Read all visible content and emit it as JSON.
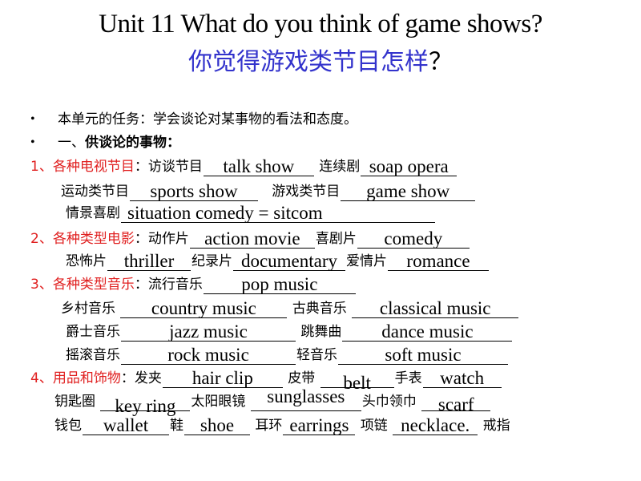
{
  "title": {
    "english": "Unit 11 What do you think of game shows?",
    "chinese": "你觉得游戏类节目怎样",
    "chinese_qmark": "？"
  },
  "bullets": [
    {
      "text": "本单元的任务：学会谈论对某事物的看法和态度。"
    },
    {
      "prefix": "一、",
      "text": "供谈论的事物："
    }
  ],
  "sections": [
    {
      "heading": "1、各种电视节目",
      "colon": "：",
      "items": [
        {
          "label": "访谈节目",
          "answer": "talk show"
        },
        {
          "label": "连续剧",
          "answer": "soap opera"
        },
        {
          "label": "运动类节目",
          "answer": "sports show"
        },
        {
          "label": "游戏类节目",
          "answer": "game show"
        },
        {
          "label": "情景喜剧",
          "answer": "situation comedy = sitcom"
        }
      ]
    },
    {
      "heading": "2、各种类型电影",
      "colon": "：",
      "items": [
        {
          "label": "动作片",
          "answer": "action movie"
        },
        {
          "label": "喜剧片",
          "answer": "comedy"
        },
        {
          "label": "恐怖片",
          "answer": "thriller"
        },
        {
          "label": "纪录片",
          "answer": "documentary"
        },
        {
          "label": "爱情片",
          "answer": "romance"
        }
      ]
    },
    {
      "heading": "3、各种类型音乐",
      "colon": "：",
      "items": [
        {
          "label": "流行音乐",
          "answer": "pop music"
        },
        {
          "label": "乡村音乐",
          "answer": "country  music"
        },
        {
          "label": "古典音乐",
          "answer": "classical music"
        },
        {
          "label": "爵士音乐",
          "answer": "jazz music"
        },
        {
          "label": "跳舞曲",
          "answer": "dance  music"
        },
        {
          "label": "摇滚音乐",
          "answer": "rock music"
        },
        {
          "label": "轻音乐",
          "answer": "soft music"
        }
      ]
    },
    {
      "heading": "4、用品和饰物",
      "colon": "：",
      "items": [
        {
          "label": "发夹",
          "answer": "hair clip"
        },
        {
          "label": "皮带",
          "answer": "belt"
        },
        {
          "label": "手表",
          "answer": "watch"
        },
        {
          "label": "钥匙圈",
          "answer": "key ring"
        },
        {
          "label": "太阳眼镜",
          "answer": "sunglasses"
        },
        {
          "label": "头巾领巾",
          "answer": "scarf"
        },
        {
          "label": "钱包",
          "answer": "wallet"
        },
        {
          "label": "鞋",
          "answer": "shoe"
        },
        {
          "label": "耳环",
          "answer": "earrings"
        },
        {
          "label": "项链",
          "answer": "necklace."
        },
        {
          "label": "戒指",
          "answer": ""
        }
      ]
    }
  ],
  "punct": {
    "period": ".",
    "bullet": "•"
  },
  "colors": {
    "heading_red": "#e02020",
    "title_blue": "#3333cc"
  }
}
